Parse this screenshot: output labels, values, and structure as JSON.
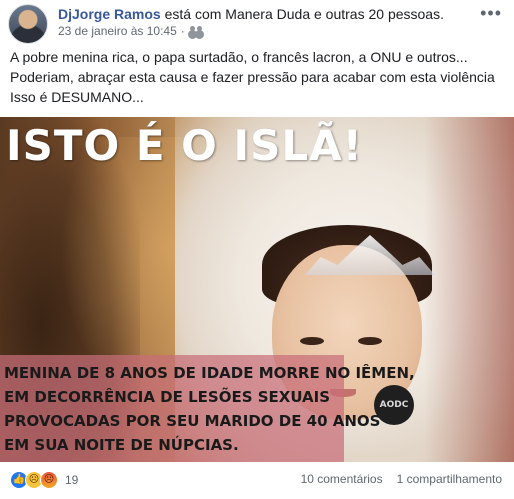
{
  "post": {
    "author": "DjJorge Ramos",
    "header_suffix": "está com Manera Duda e outras 20 pessoas.",
    "timestamp": "23 de janeiro às 10:45",
    "separator": "·",
    "more_icon": "•••",
    "text_lines": [
      "A pobre menina rica, o papa surtadão, o francês lacron, a ONU e outros...",
      "Poderiam, abraçar esta causa e fazer pressão para acabar com esta violência",
      "Isso é DESUMANO..."
    ]
  },
  "image": {
    "headline": "ISTO É O ISLÃ!",
    "caption_lines": [
      "Menina de 8 anos de idade morre no Iêmen,",
      "em decorrência de lesões sexuais",
      "provocadas por seu marido de 40 anos",
      "em sua noite de núpcias."
    ],
    "logo_text": "AODC"
  },
  "footer": {
    "reaction_icons": [
      "like-icon",
      "sad-icon",
      "angry-icon"
    ],
    "reaction_count": "19",
    "comments": "10 comentários",
    "shares": "1 compartilhamento"
  }
}
